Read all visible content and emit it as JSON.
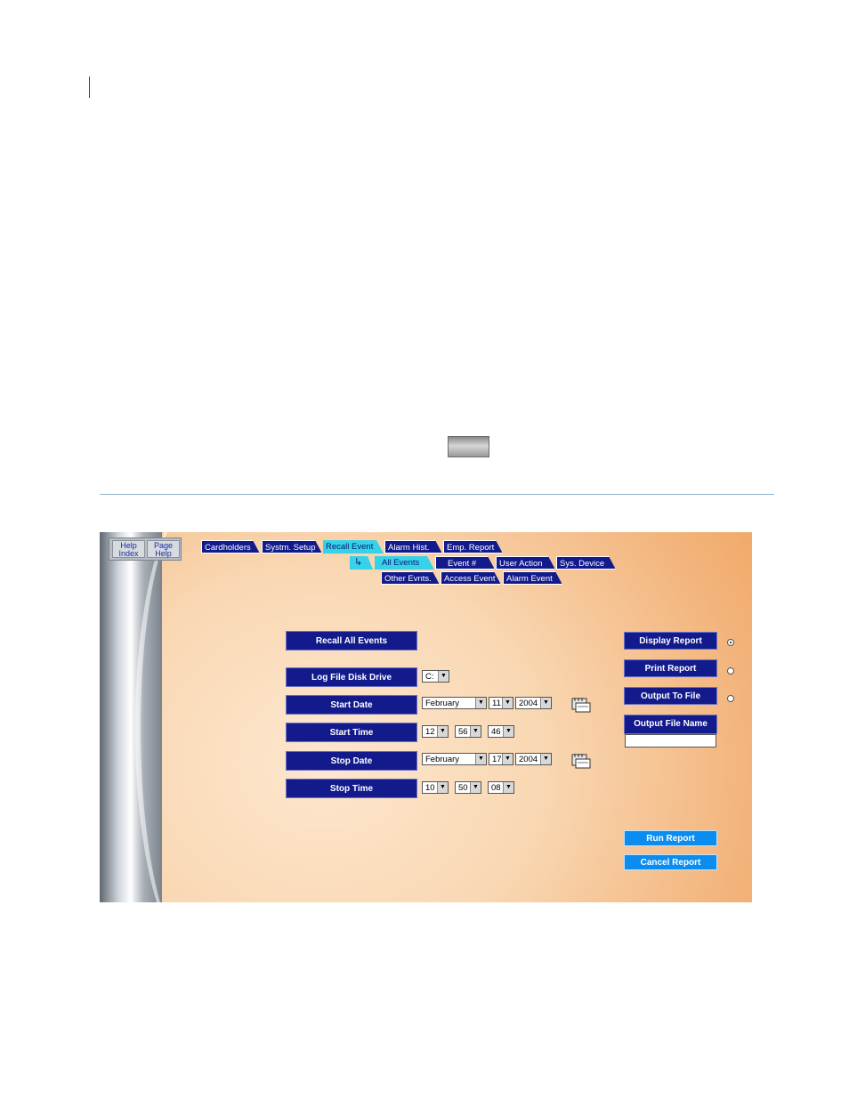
{
  "help": {
    "index_label": "Help Index",
    "page_label": "Page Help"
  },
  "tabs_row1": [
    "Cardholders",
    "Systm. Setup",
    "Recall Event",
    "Alarm Hist.",
    "Emp. Report"
  ],
  "tabs_row2": [
    "All Events",
    "Event #",
    "User Action",
    "Sys. Device"
  ],
  "tabs_row3": [
    "Other Evnts.",
    "Access Event",
    "Alarm Event"
  ],
  "form": {
    "recall_all_label": "Recall All Events",
    "log_drive_label": "Log File Disk Drive",
    "log_drive_value": "C:",
    "start_date_label": "Start Date",
    "start_date": {
      "month": "February",
      "day": "11",
      "year": "2004"
    },
    "start_time_label": "Start Time",
    "start_time": {
      "hour": "12",
      "minute": "56",
      "second": "46"
    },
    "stop_date_label": "Stop Date",
    "stop_date": {
      "month": "February",
      "day": "17",
      "year": "2004"
    },
    "stop_time_label": "Stop Time",
    "stop_time": {
      "hour": "10",
      "minute": "50",
      "second": "08"
    }
  },
  "output": {
    "display_label": "Display Report",
    "print_label": "Print Report",
    "file_label": "Output To File",
    "filename_label": "Output File Name",
    "filename_value": "",
    "selected": "display"
  },
  "actions": {
    "run_label": "Run Report",
    "cancel_label": "Cancel Report"
  }
}
